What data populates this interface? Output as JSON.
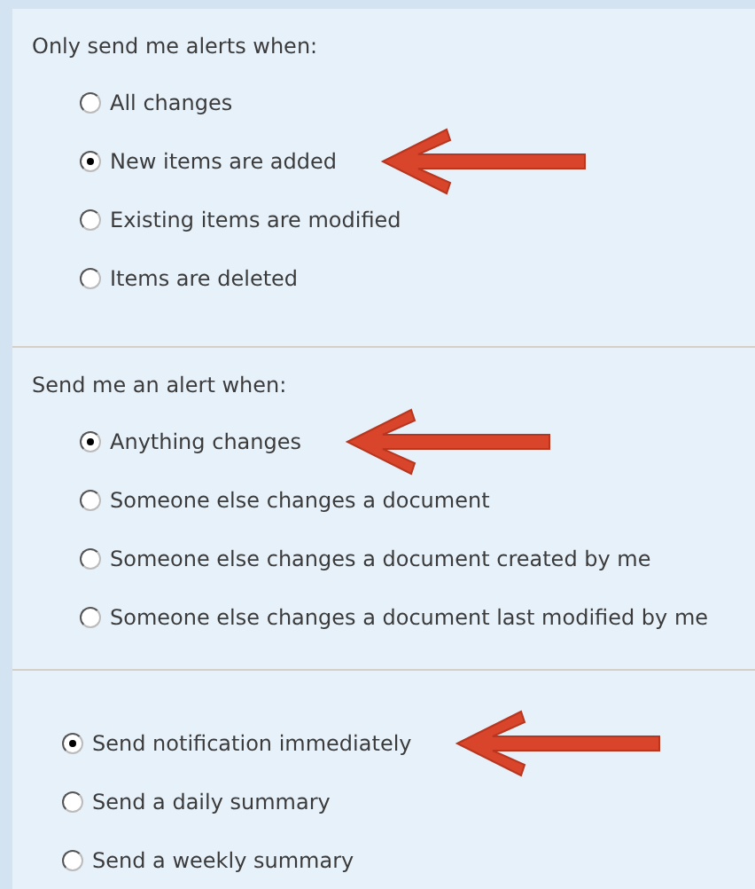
{
  "sections": [
    {
      "heading": "Only send me alerts when:",
      "options": [
        {
          "label": "All changes",
          "selected": false,
          "pointed": false
        },
        {
          "label": "New items are added",
          "selected": true,
          "pointed": true
        },
        {
          "label": "Existing items are modified",
          "selected": false,
          "pointed": false
        },
        {
          "label": "Items are deleted",
          "selected": false,
          "pointed": false
        }
      ]
    },
    {
      "heading": "Send me an alert when:",
      "options": [
        {
          "label": "Anything changes",
          "selected": true,
          "pointed": true
        },
        {
          "label": "Someone else changes a document",
          "selected": false,
          "pointed": false
        },
        {
          "label": "Someone else changes a document created by me",
          "selected": false,
          "pointed": false
        },
        {
          "label": "Someone else changes a document last modified by me",
          "selected": false,
          "pointed": false
        }
      ]
    },
    {
      "options": [
        {
          "label": "Send notification immediately",
          "selected": true,
          "pointed": true
        },
        {
          "label": "Send a daily summary",
          "selected": false,
          "pointed": false
        },
        {
          "label": "Send a weekly summary",
          "selected": false,
          "pointed": false
        }
      ]
    }
  ]
}
